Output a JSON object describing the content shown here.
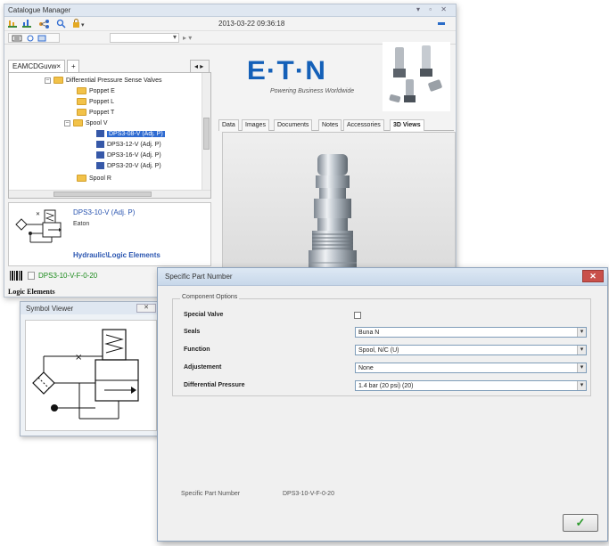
{
  "catalogue_manager": {
    "title": "Catalogue Manager",
    "window_controls": "▾ ▫ ✕",
    "timestamp": "2013-03-22 09:36:18",
    "tree_tab_label": "EAMCDGuvw",
    "tree_tab_close": "×",
    "tree_tab_add": "+",
    "tree_tab_nav": "◂ ▸",
    "tree": [
      {
        "label": "Differential Pressure Sense Valves",
        "type": "folder",
        "expander": "–"
      },
      {
        "label": "Poppet E",
        "type": "folder"
      },
      {
        "label": "Poppet L",
        "type": "folder"
      },
      {
        "label": "Poppet T",
        "type": "folder"
      },
      {
        "label": "Spool V",
        "type": "folder",
        "expander": "–"
      },
      {
        "label": "DPS3-08-V (Adj. P)",
        "type": "part",
        "selected": true
      },
      {
        "label": "DPS3-12-V (Adj. P)",
        "type": "part"
      },
      {
        "label": "DPS3-16-V (Adj. P)",
        "type": "part"
      },
      {
        "label": "DPS3-20-V (Adj. P)",
        "type": "part"
      },
      {
        "label": "Spool R",
        "type": "folder"
      }
    ],
    "info": {
      "part_name": "DPS3-10-V (Adj. P)",
      "manufacturer": "Eaton",
      "category": "Hydraulic\\Logic Elements"
    },
    "code": "DPS3-10-V-F-0-20",
    "footer_label": "Logic Elements",
    "brand": "E·T·N",
    "brand_tagline": "Powering Business Worldwide",
    "right_tabs": [
      "Data",
      "Images",
      "Documents",
      "Notes",
      "Accessories",
      "3D Views"
    ],
    "active_right_tab": "3D Views",
    "accent_color": "#1460b8"
  },
  "symbol_viewer": {
    "title": "Symbol Viewer",
    "close_label": "✕"
  },
  "dialog": {
    "title": "Specific Part Number",
    "close_label": "✕",
    "group_label": "Component Options",
    "rows": [
      {
        "label": "Special Valve",
        "kind": "checkbox",
        "checked": false
      },
      {
        "label": "Seals",
        "kind": "select",
        "value": "Buna N"
      },
      {
        "label": "Function",
        "kind": "select",
        "value": "Spool, N/C (U)"
      },
      {
        "label": "Adjustement",
        "kind": "select",
        "value": "None"
      },
      {
        "label": "Differential Pressure",
        "kind": "select",
        "value": "1.4 bar (20 psi) (20)"
      }
    ],
    "specific_part_number_label": "Specific Part Number",
    "specific_part_number_value": "DPS3-10-V-F-0-20",
    "ok_label": "✓"
  }
}
